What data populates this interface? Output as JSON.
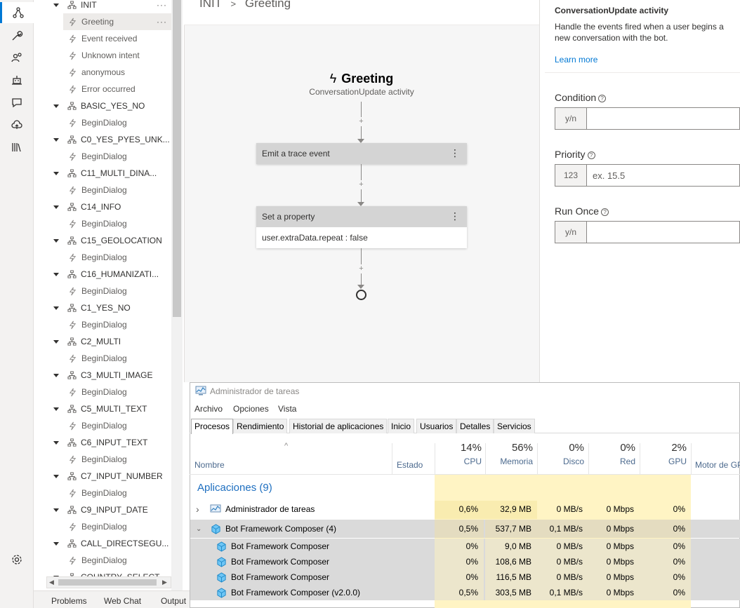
{
  "rail": {
    "items": [
      "design-icon",
      "wrench-icon",
      "users-icon",
      "bot-icon",
      "chat-icon",
      "cloud-upload-icon",
      "library-icon",
      "settings-icon"
    ]
  },
  "tree": {
    "items": [
      {
        "label": "INIT",
        "type": "dialog",
        "expanded": true
      },
      {
        "label": "Greeting",
        "type": "trigger",
        "selected": true
      },
      {
        "label": "Event received",
        "type": "trigger"
      },
      {
        "label": "Unknown intent",
        "type": "trigger"
      },
      {
        "label": "anonymous",
        "type": "trigger"
      },
      {
        "label": "Error occurred",
        "type": "trigger"
      },
      {
        "label": "BASIC_YES_NO",
        "type": "dialog"
      },
      {
        "label": "BeginDialog",
        "type": "trigger"
      },
      {
        "label": "C0_YES_PYES_UNK...",
        "type": "dialog"
      },
      {
        "label": "BeginDialog",
        "type": "trigger"
      },
      {
        "label": "C11_MULTI_DINA...",
        "type": "dialog"
      },
      {
        "label": "BeginDialog",
        "type": "trigger"
      },
      {
        "label": "C14_INFO",
        "type": "dialog"
      },
      {
        "label": "BeginDialog",
        "type": "trigger"
      },
      {
        "label": "C15_GEOLOCATION",
        "type": "dialog"
      },
      {
        "label": "BeginDialog",
        "type": "trigger"
      },
      {
        "label": "C16_HUMANIZATI...",
        "type": "dialog"
      },
      {
        "label": "BeginDialog",
        "type": "trigger"
      },
      {
        "label": "C1_YES_NO",
        "type": "dialog"
      },
      {
        "label": "BeginDialog",
        "type": "trigger"
      },
      {
        "label": "C2_MULTI",
        "type": "dialog"
      },
      {
        "label": "BeginDialog",
        "type": "trigger"
      },
      {
        "label": "C3_MULTI_IMAGE",
        "type": "dialog"
      },
      {
        "label": "BeginDialog",
        "type": "trigger"
      },
      {
        "label": "C5_MULTI_TEXT",
        "type": "dialog"
      },
      {
        "label": "BeginDialog",
        "type": "trigger"
      },
      {
        "label": "C6_INPUT_TEXT",
        "type": "dialog"
      },
      {
        "label": "BeginDialog",
        "type": "trigger"
      },
      {
        "label": "C7_INPUT_NUMBER",
        "type": "dialog"
      },
      {
        "label": "BeginDialog",
        "type": "trigger"
      },
      {
        "label": "C9_INPUT_DATE",
        "type": "dialog"
      },
      {
        "label": "BeginDialog",
        "type": "trigger"
      },
      {
        "label": "CALL_DIRECTSEGU...",
        "type": "dialog"
      },
      {
        "label": "BeginDialog",
        "type": "trigger"
      },
      {
        "label": "COUNTRY_SELECT",
        "type": "dialog"
      }
    ]
  },
  "bottom_tabs": [
    "Problems",
    "Web Chat",
    "Output"
  ],
  "breadcrumb": {
    "root": "INIT",
    "separator": ">",
    "current": "Greeting"
  },
  "flow": {
    "trigger_title": "Greeting",
    "trigger_subtitle": "ConversationUpdate activity",
    "node1": {
      "title": "Emit a trace event"
    },
    "node2": {
      "title": "Set a property",
      "body": "user.extraData.repeat : false"
    }
  },
  "props": {
    "subtitle": "ConversationUpdate activity",
    "description": "Handle the events fired when a user begins a new conversation with the bot.",
    "learn_more": "Learn more",
    "condition": {
      "label": "Condition",
      "prefix": "y/n",
      "value": ""
    },
    "priority": {
      "label": "Priority",
      "prefix": "123",
      "placeholder": "ex. 15.5"
    },
    "run_once": {
      "label": "Run Once",
      "prefix": "y/n",
      "value": ""
    }
  },
  "taskmanager": {
    "title": "Administrador de tareas",
    "menu": [
      "Archivo",
      "Opciones",
      "Vista"
    ],
    "tabs": [
      "Procesos",
      "Rendimiento",
      "Historial de aplicaciones",
      "Inicio",
      "Usuarios",
      "Detalles",
      "Servicios"
    ],
    "columns": {
      "name": "Nombre",
      "status": "Estado",
      "cpu": {
        "label": "CPU",
        "pct": "14%"
      },
      "mem": {
        "label": "Memoria",
        "pct": "56%"
      },
      "disk": {
        "label": "Disco",
        "pct": "0%"
      },
      "net": {
        "label": "Red",
        "pct": "0%"
      },
      "gpu": {
        "label": "GPU",
        "pct": "2%"
      },
      "gpu_engine": {
        "label": "Motor de GPU"
      }
    },
    "group_label": "Aplicaciones (9)",
    "rows": [
      {
        "name": "Administrador de tareas",
        "cpu": "0,6%",
        "mem": "32,9 MB",
        "disk": "0 MB/s",
        "net": "0 Mbps",
        "gpu": "0%"
      },
      {
        "name": "Bot Framework Composer (4)",
        "cpu": "0,5%",
        "mem": "537,7 MB",
        "disk": "0,1 MB/s",
        "net": "0 Mbps",
        "gpu": "0%"
      },
      {
        "name": "Bot Framework Composer",
        "cpu": "0%",
        "mem": "9,0 MB",
        "disk": "0 MB/s",
        "net": "0 Mbps",
        "gpu": "0%"
      },
      {
        "name": "Bot Framework Composer",
        "cpu": "0%",
        "mem": "108,6 MB",
        "disk": "0 MB/s",
        "net": "0 Mbps",
        "gpu": "0%"
      },
      {
        "name": "Bot Framework Composer",
        "cpu": "0%",
        "mem": "116,5 MB",
        "disk": "0 MB/s",
        "net": "0 Mbps",
        "gpu": "0%"
      },
      {
        "name": "Bot Framework Composer (v2.0.0)",
        "cpu": "0,5%",
        "mem": "303,5 MB",
        "disk": "0,1 MB/s",
        "net": "0 Mbps",
        "gpu": "0%"
      }
    ]
  },
  "colors": {
    "accent": "#0078d4",
    "heat": "#fff4c4",
    "group_link": "#1e6fc0"
  }
}
